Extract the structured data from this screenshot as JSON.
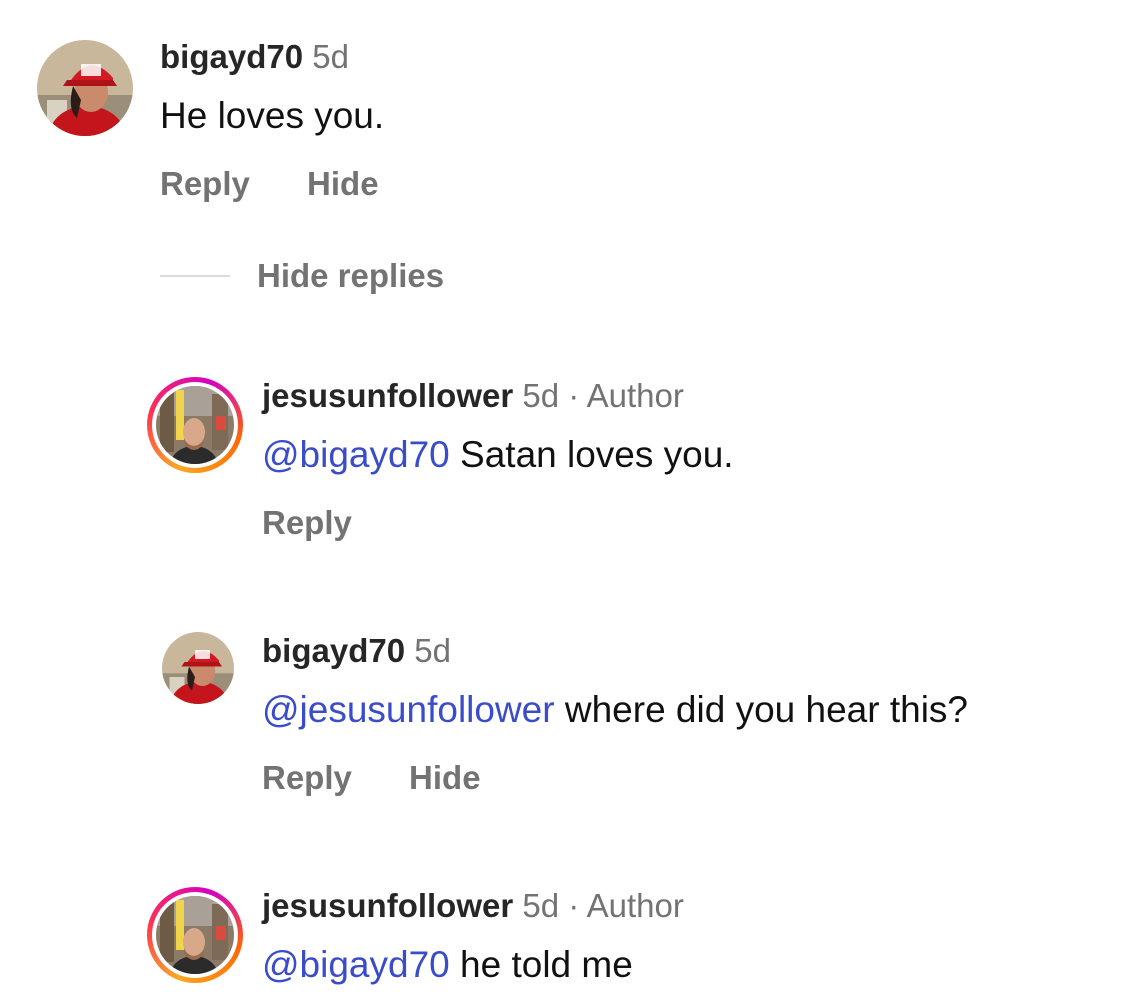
{
  "comments": [
    {
      "username": "bigayd70",
      "time": "5d",
      "author_tag": "",
      "mention": "",
      "text": "He loves you.",
      "reply_label": "Reply",
      "hide_label": "Hide"
    },
    {
      "username": "jesusunfollower",
      "time": "5d",
      "author_tag": "· Author",
      "mention": "@bigayd70",
      "text": " Satan loves you.",
      "reply_label": "Reply",
      "hide_label": ""
    },
    {
      "username": "bigayd70",
      "time": "5d",
      "author_tag": "",
      "mention": "@jesusunfollower",
      "text": " where did you hear this?",
      "reply_label": "Reply",
      "hide_label": "Hide"
    },
    {
      "username": "jesusunfollower",
      "time": "5d",
      "author_tag": "· Author",
      "mention": "@bigayd70",
      "text": " he told me",
      "reply_label": "",
      "hide_label": ""
    }
  ],
  "hide_replies_label": "Hide replies",
  "colors": {
    "mention": "#3b4cca",
    "secondary_text": "#737373",
    "story_ring": [
      "#f9a825",
      "#ff2d55",
      "#d300c5"
    ]
  }
}
